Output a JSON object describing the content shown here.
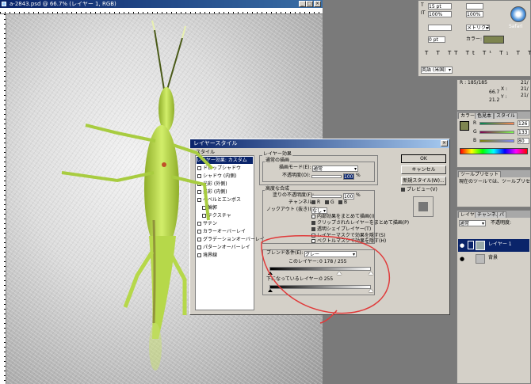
{
  "document": {
    "title": "a-2843.psd @ 66.7% (レイヤー 1, RGB)",
    "controls": [
      "_",
      "□",
      "×"
    ]
  },
  "safari": {
    "label": "Safari"
  },
  "character_palette": {
    "font": "英語 (米国)",
    "values": [
      "15 pt",
      "100%",
      "100%",
      "メトリクス",
      "0 pt"
    ],
    "color_label": "カラー:",
    "style_buttons": [
      "T",
      "T",
      "TT",
      "Tt",
      "T¹",
      "T₁",
      "T",
      "T"
    ]
  },
  "info_palette": {
    "rows": [
      "R : 185/185",
      "G :",
      "B :"
    ],
    "values": [
      "21/",
      "21/",
      "21/"
    ],
    "xy": [
      "X :",
      "Y :"
    ],
    "xy_vals": [
      "66.7",
      "21.2"
    ]
  },
  "color_palette": {
    "tabs": [
      "カラー",
      "色見本",
      "スタイル"
    ],
    "channels": [
      "R",
      "G",
      "B"
    ],
    "values": [
      "126",
      "133",
      "80"
    ]
  },
  "tool_presets": {
    "tab": "ツールプリセット",
    "message": "現在のツールでは、ツールプリセットを定義"
  },
  "layers_palette": {
    "tabs": [
      "レイヤー",
      "チャンネル",
      "パ"
    ],
    "blend_mode": "通常",
    "opacity_label": "不透明度:",
    "layers": [
      {
        "name": "レイヤー 1",
        "selected": true
      },
      {
        "name": "背景",
        "selected": false
      }
    ]
  },
  "dialog": {
    "title": "レイヤースタイル",
    "close": "×",
    "style_list_header": "スタイル",
    "styles": [
      {
        "label": "レイヤー効果: カスタム",
        "checked": null,
        "selected": true
      },
      {
        "label": "ドロップシャドウ",
        "checked": false
      },
      {
        "label": "シャドウ (内側)",
        "checked": false
      },
      {
        "label": "光彩 (外側)",
        "checked": false
      },
      {
        "label": "光彩 (内側)",
        "checked": false
      },
      {
        "label": "ベベルとエンボス",
        "checked": false
      },
      {
        "label": "輪郭",
        "checked": false,
        "indent": true
      },
      {
        "label": "テクスチャ",
        "checked": false,
        "indent": true
      },
      {
        "label": "サテン",
        "checked": false
      },
      {
        "label": "カラーオーバーレイ",
        "checked": false
      },
      {
        "label": "グラデーションオーバーレイ",
        "checked": false
      },
      {
        "label": "パターンオーバーレイ",
        "checked": false
      },
      {
        "label": "境界線",
        "checked": false
      }
    ],
    "effects": {
      "group_title": "レイヤー効果",
      "general_title": "通常の描画",
      "blend_mode_label": "描画モード(E):",
      "blend_mode_value": "通常",
      "opacity_label": "不透明度(O):",
      "opacity_value": "100",
      "percent": "%"
    },
    "advanced": {
      "group_title": "高度な合成",
      "fill_opacity_label": "塗りの不透明度(F):",
      "fill_opacity_value": "100",
      "percent": "%",
      "channels_label": "チャンネル:",
      "channels": [
        "R",
        "G",
        "B"
      ],
      "knockout_label": "ノックアウト (抜き)(K):",
      "knockout_value": "なし",
      "options": [
        {
          "label": "内部効果をまとめて描画(I)",
          "checked": false
        },
        {
          "label": "クリップされたレイヤーをまとめて描画(P)",
          "checked": true
        },
        {
          "label": "透明シェイプレイヤー(T)",
          "checked": true
        },
        {
          "label": "レイヤーマスクで効果を隠す(S)",
          "checked": false
        },
        {
          "label": "ベクトルマスクで効果を隠す(H)",
          "checked": false
        }
      ]
    },
    "blend_if": {
      "label": "ブレンド条件(E):",
      "value": "グレー",
      "this_layer_label": "このレイヤー:",
      "this_layer_values": "0      178 / 255",
      "this_layer_black": 0,
      "this_layer_white_low": 178,
      "this_layer_white_high": 255,
      "underlying_label": "下になっているレイヤー:",
      "underlying_values": "0      255",
      "underlying_black": 0,
      "underlying_white": 255
    },
    "buttons": {
      "ok": "OK",
      "cancel": "キャンセル",
      "new_style": "新規スタイル(W)...",
      "preview": "プレビュー(V)"
    },
    "preview_checked": true
  },
  "colors": {
    "annotation": "#e03a3a",
    "grasshopper": "#b6d84a",
    "title_bar": "#0a246a",
    "selection": "#0a246a",
    "foreground_swatch": "#7e8550"
  }
}
